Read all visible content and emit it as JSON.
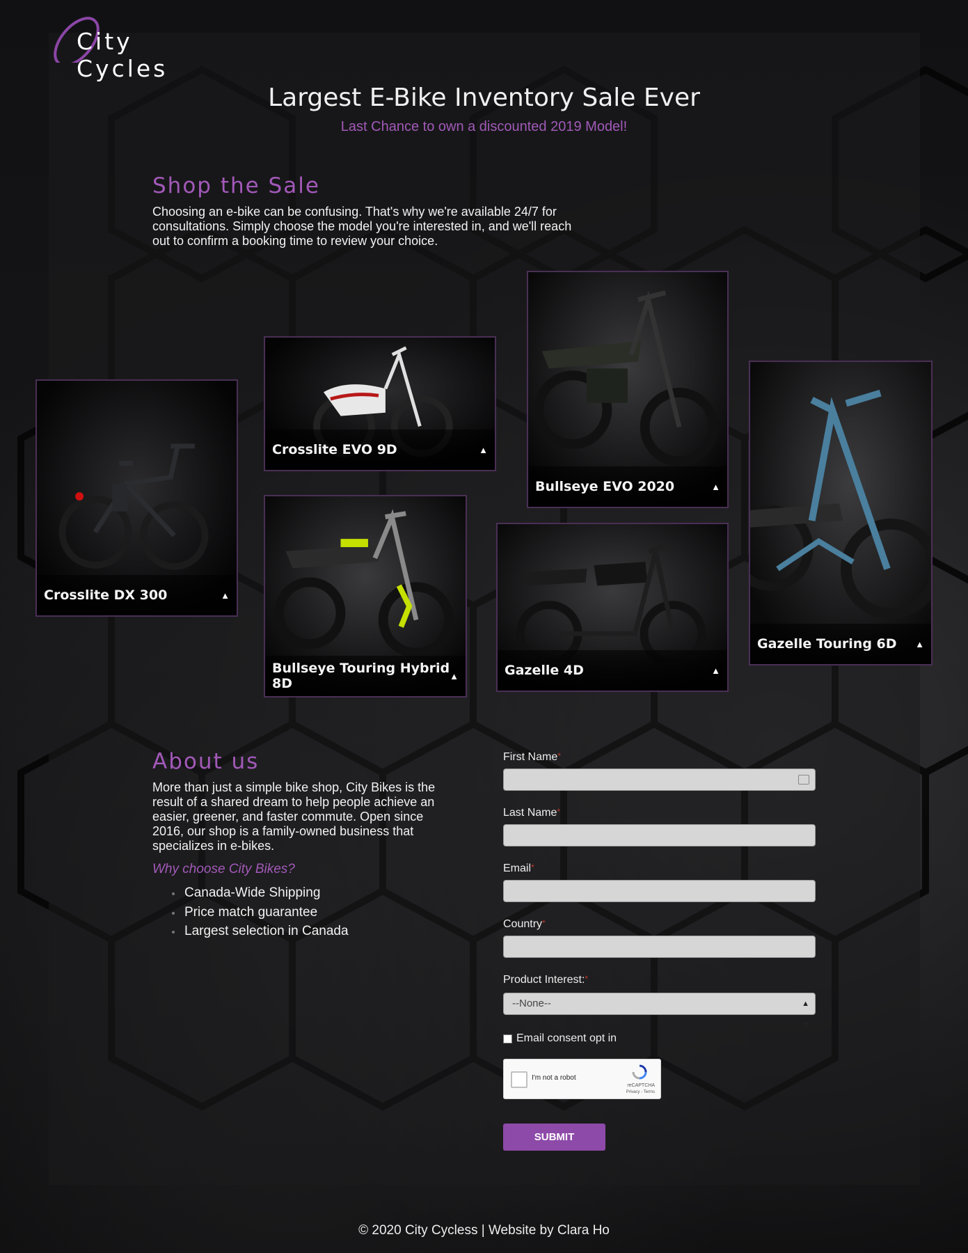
{
  "brand": {
    "name": "City Cycles"
  },
  "hero": {
    "title": "Largest E-Bike Inventory Sale Ever",
    "subtitle": "Last Chance to own a discounted 2019 Model!"
  },
  "shop": {
    "heading": "Shop the Sale",
    "lines": [
      "Choosing an e-bike can be confusing. That's why we're available 24/7 for",
      "consultations. Simply choose the model you're interested in, and we'll reach",
      "out to confirm a booking time to review your choice."
    ]
  },
  "products": [
    {
      "name": "Crosslite DX 300",
      "frame_color": "#1d1f22"
    },
    {
      "name": "Crosslite EVO 9D",
      "frame_color": "#e8e8e8"
    },
    {
      "name": "Bullseye EVO 2020",
      "frame_color": "#2a2e26"
    },
    {
      "name": "Gazelle Touring 6D",
      "frame_color": "#4a7f9e"
    },
    {
      "name": "Bullseye Touring Hybrid 8D",
      "frame_color": "#8a8a8a"
    },
    {
      "name": "Gazelle 4D",
      "frame_color": "#1a1a1a"
    }
  ],
  "about": {
    "heading": "About us",
    "lines": [
      "More than just a simple bike shop, City Bikes is the",
      "result of a shared dream to help people achieve an",
      "easier, greener, and faster commute. Open since",
      "2016, our shop is a family-owned business that",
      "specializes in e-bikes."
    ],
    "why_heading": "Why choose City Bikes?",
    "reasons": [
      "Canada-Wide Shipping",
      "Price match guarantee",
      "Largest selection in Canada"
    ]
  },
  "form": {
    "first_name_label": "First Name",
    "last_name_label": "Last Name",
    "email_label": "Email",
    "country_label": "Country",
    "product_interest_label": "Product Interest:",
    "required_mark": "*",
    "product_interest_value": "--None--",
    "consent_label": "Email consent opt in",
    "recaptcha_label": "I'm not a robot",
    "recaptcha_brand": "reCAPTCHA",
    "recaptcha_links": "Privacy - Terms",
    "submit_label": "SUBMIT"
  },
  "footer": {
    "text": "© 2020 City Cycless | Website by Clara Ho"
  },
  "colors": {
    "accent": "#a259b8",
    "button": "#8d4aa8",
    "background": "#111113",
    "card_border": "#4a2f55"
  }
}
